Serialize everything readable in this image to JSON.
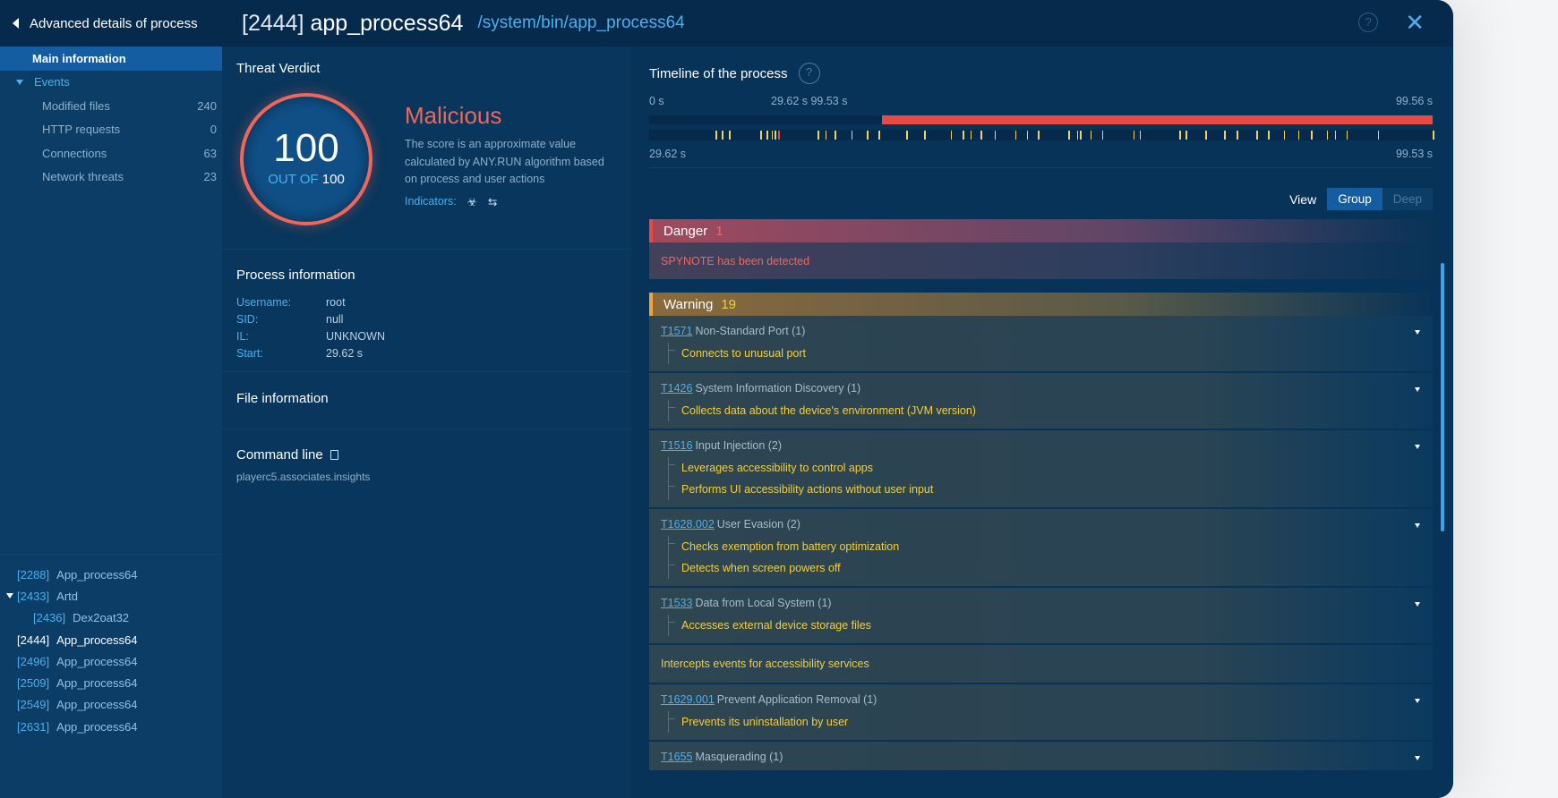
{
  "header": {
    "back_label": "Advanced details of process",
    "pid": "[2444]",
    "name": "app_process64",
    "path": "/system/bin/app_process64",
    "help_icon": "?",
    "close_icon": "✕"
  },
  "sidebar": {
    "main_label": "Main information",
    "events_label": "Events",
    "events": [
      {
        "label": "Modified files",
        "count": "240"
      },
      {
        "label": "HTTP requests",
        "count": "0"
      },
      {
        "label": "Connections",
        "count": "63"
      },
      {
        "label": "Network threats",
        "count": "23"
      }
    ],
    "tree": [
      {
        "pid": "[2288]",
        "name": "App_process64"
      },
      {
        "pid": "[2433]",
        "name": "Artd"
      },
      {
        "pid": "[2436]",
        "name": "Dex2oat32"
      },
      {
        "pid": "[2444]",
        "name": "App_process64"
      },
      {
        "pid": "[2496]",
        "name": "App_process64"
      },
      {
        "pid": "[2509]",
        "name": "App_process64"
      },
      {
        "pid": "[2549]",
        "name": "App_process64"
      },
      {
        "pid": "[2631]",
        "name": "App_process64"
      }
    ]
  },
  "verdict": {
    "heading": "Threat Verdict",
    "score": "100",
    "out_of_label": "OUT OF",
    "out_of_value": "100",
    "label": "Malicious",
    "description": "The score is an approximate value calculated by ANY.RUN algorithm based on process and user actions",
    "indicators_label": "Indicators:",
    "indicator_icons": [
      "biohazard-icon",
      "network-exchange-icon"
    ],
    "color": "#f0665a"
  },
  "process_info": {
    "heading": "Process information",
    "rows": [
      {
        "k": "Username:",
        "v": "root"
      },
      {
        "k": "SID:",
        "v": "null"
      },
      {
        "k": "IL:",
        "v": "UNKNOWN"
      },
      {
        "k": "Start:",
        "v": "29.62 s"
      }
    ]
  },
  "file_info": {
    "heading": "File information"
  },
  "command_line": {
    "heading": "Command line",
    "value": "playerc5.associates.insights"
  },
  "timeline": {
    "heading": "Timeline of the process",
    "start_label": "0 s",
    "mid_label": "29.62 s 99.53 s",
    "end_label": "99.56 s",
    "bottom_start": "29.62 s",
    "bottom_end": "99.53 s",
    "total_s": 99.56,
    "active_start_s": 29.62,
    "active_end_s": 99.56,
    "events_fraction": [
      0.085,
      0.093,
      0.102,
      0.142,
      0.15,
      0.156,
      0.16,
      0.215,
      0.225,
      0.237,
      0.258,
      0.278,
      0.293,
      0.328,
      0.351,
      0.385,
      0.4,
      0.41,
      0.423,
      0.441,
      0.467,
      0.482,
      0.496,
      0.535,
      0.546,
      0.55,
      0.563,
      0.578,
      0.618,
      0.626,
      0.677,
      0.685,
      0.71,
      0.734,
      0.75,
      0.775,
      0.79,
      0.81,
      0.828,
      0.845,
      0.865,
      0.875,
      0.89,
      0.93,
      1.0
    ],
    "red_events_fraction": [
      0.165
    ]
  },
  "view": {
    "label": "View",
    "options": [
      "Group",
      "Deep"
    ],
    "selected": "Group"
  },
  "danger": {
    "label": "Danger",
    "count": "1",
    "items": [
      "SPYNOTE has been detected"
    ]
  },
  "warning": {
    "label": "Warning",
    "count": "19",
    "items": [
      {
        "id": "T1571",
        "name": "Non-Standard Port (1)",
        "subs": [
          "Connects to unusual port"
        ]
      },
      {
        "id": "T1426",
        "name": "System Information Discovery (1)",
        "subs": [
          "Collects data about the device's environment (JVM version)"
        ]
      },
      {
        "id": "T1516",
        "name": "Input Injection (2)",
        "subs": [
          "Leverages accessibility to control apps",
          "Performs UI accessibility actions without user input"
        ]
      },
      {
        "id": "T1628.002",
        "name": "User Evasion (2)",
        "subs": [
          "Checks exemption from battery optimization",
          "Detects when screen powers off"
        ]
      },
      {
        "id": "T1533",
        "name": "Data from Local System (1)",
        "subs": [
          "Accesses external device storage files"
        ]
      },
      {
        "plain": "Intercepts events for accessibility services"
      },
      {
        "id": "T1629.001",
        "name": "Prevent Application Removal (1)",
        "subs": [
          "Prevents its uninstallation by user"
        ]
      },
      {
        "id": "T1655",
        "name": "Masquerading (1)",
        "subs": []
      }
    ]
  }
}
